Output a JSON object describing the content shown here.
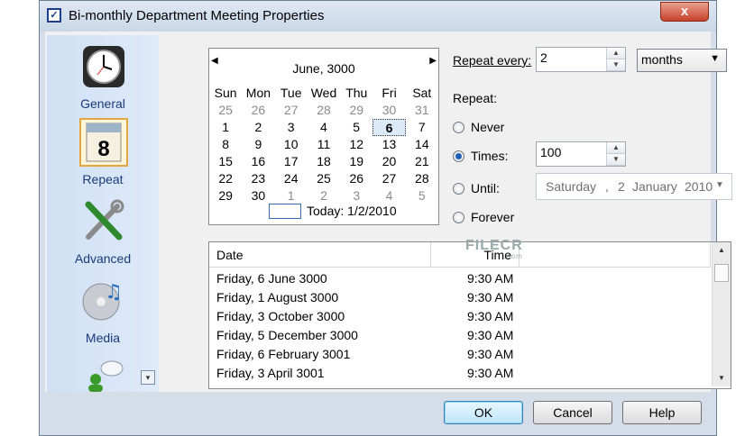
{
  "window": {
    "title": "Bi-monthly Department Meeting Properties",
    "close_label": "x"
  },
  "sidebar": {
    "items": [
      {
        "label": "General",
        "icon": "clock-icon"
      },
      {
        "label": "Repeat",
        "icon": "calendar-icon",
        "selected": true
      },
      {
        "label": "Advanced",
        "icon": "tools-icon"
      },
      {
        "label": "Media",
        "icon": "media-icon"
      },
      {
        "label": "",
        "icon": "contacts-icon"
      }
    ],
    "more_glyph": "▾"
  },
  "calendar": {
    "month_label": "June, 3000",
    "prev_glyph": "◀",
    "next_glyph": "▶",
    "weekdays": [
      "Sun",
      "Mon",
      "Tue",
      "Wed",
      "Thu",
      "Fri",
      "Sat"
    ],
    "weeks": [
      [
        "25",
        "26",
        "27",
        "28",
        "29",
        "30",
        "31"
      ],
      [
        "1",
        "2",
        "3",
        "4",
        "5",
        "6",
        "7"
      ],
      [
        "8",
        "9",
        "10",
        "11",
        "12",
        "13",
        "14"
      ],
      [
        "15",
        "16",
        "17",
        "18",
        "19",
        "20",
        "21"
      ],
      [
        "22",
        "23",
        "24",
        "25",
        "26",
        "27",
        "28"
      ],
      [
        "29",
        "30",
        "1",
        "2",
        "3",
        "4",
        "5"
      ]
    ],
    "selected_day": "6",
    "today_label": "Today: 1/2/2010"
  },
  "repeat": {
    "every_label": "Repeat every:",
    "every_value": "2",
    "unit_value": "months",
    "repeat_label": "Repeat:",
    "options": [
      {
        "label": "Never",
        "checked": false
      },
      {
        "label": "Times:",
        "checked": true
      },
      {
        "label": "Until:",
        "checked": false
      },
      {
        "label": "Forever",
        "checked": false
      }
    ],
    "times_value": "100",
    "until_date": {
      "weekday": "Saturday",
      "sep": ",",
      "day": "2",
      "month": "January",
      "year": "2010"
    }
  },
  "occurrences": {
    "columns": [
      "Date",
      "Time"
    ],
    "rows": [
      {
        "date": "Friday, 6 June 3000",
        "time": "9:30 AM"
      },
      {
        "date": "Friday, 1 August 3000",
        "time": "9:30 AM"
      },
      {
        "date": "Friday, 3 October 3000",
        "time": "9:30 AM"
      },
      {
        "date": "Friday, 5 December 3000",
        "time": "9:30 AM"
      },
      {
        "date": "Friday, 6 February 3001",
        "time": "9:30 AM"
      },
      {
        "date": "Friday, 3 April 3001",
        "time": "9:30 AM"
      }
    ]
  },
  "watermark": {
    "text": "FILECR",
    "sub": ".com"
  },
  "buttons": {
    "ok": "OK",
    "cancel": "Cancel",
    "help": "Help"
  }
}
